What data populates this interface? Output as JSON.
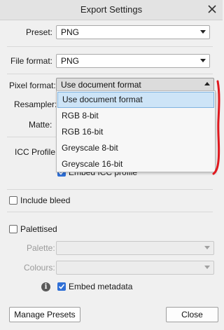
{
  "window": {
    "title": "Export Settings"
  },
  "preset": {
    "label": "Preset:",
    "value": "PNG"
  },
  "file_format": {
    "label": "File format:",
    "value": "PNG"
  },
  "pixel_format": {
    "label": "Pixel format:",
    "value": "Use document format",
    "options": [
      "Use document format",
      "RGB 8-bit",
      "RGB 16-bit",
      "Greyscale 8-bit",
      "Greyscale 16-bit"
    ]
  },
  "resampler": {
    "label": "Resampler:"
  },
  "matte": {
    "label": "Matte:"
  },
  "icc_profile": {
    "label": "ICC Profile:",
    "embed_label": "Embed ICC profile",
    "embed_checked": true
  },
  "include_bleed": {
    "label": "Include bleed",
    "checked": false
  },
  "palettised": {
    "label": "Palettised",
    "checked": false
  },
  "palette": {
    "label": "Palette:",
    "value": ""
  },
  "colours": {
    "label": "Colours:",
    "value": ""
  },
  "metadata": {
    "info_icon": "info-icon",
    "label": "Embed metadata",
    "checked": true
  },
  "buttons": {
    "manage_presets": "Manage Presets",
    "close": "Close"
  },
  "colors": {
    "accent": "#2f6fd6",
    "annotation": "#e0191f",
    "selection": "#cde4f7"
  }
}
